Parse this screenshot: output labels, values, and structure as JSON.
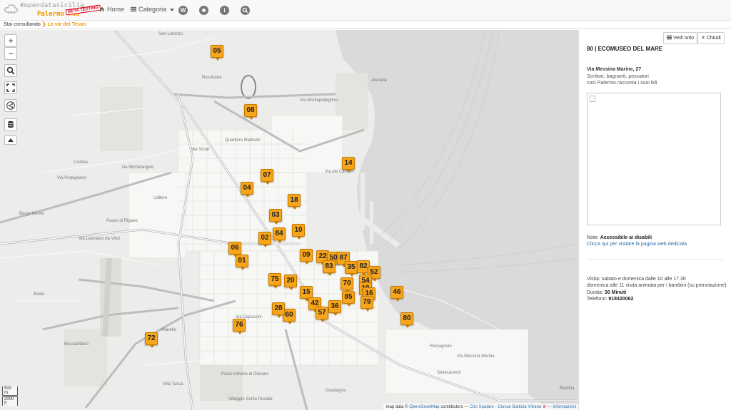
{
  "header": {
    "brand_top": "#opendatasicilia",
    "brand_city": "Palermo Hub",
    "beta_badge": "BETA TESTING",
    "nav": {
      "home": "Home",
      "category": "Categoria"
    },
    "icons": [
      "cloud-logo-icon",
      "home-icon",
      "list-icon",
      "wikipedia-icon",
      "compass-icon",
      "info-icon",
      "search-icon"
    ]
  },
  "breadcrumb": {
    "prefix": "Stai consultando",
    "current": "Le vie dei Tesori"
  },
  "map": {
    "zoom_in": "+",
    "zoom_out": "−",
    "scale_m": "500 m",
    "scale_ft": "2000 ft",
    "attribution": {
      "prefix": "map data ©",
      "osm": "OpenStreetMap",
      "mid": "contributors —",
      "authors": "Ciro Spataro - Giovan Battista Vitrano",
      "info": "— Informazioni"
    },
    "street_labels": [
      "San Lorenzo",
      "Resuttana",
      "Cruillas",
      "Uditore",
      "Borgo Nuovo",
      "Passo di Rigano",
      "Baida",
      "Boccadifalco",
      "Altarello",
      "Arenella",
      "Villa Tasca",
      "Villaggio Santa Rosalia",
      "Guadagna",
      "Settecannoli",
      "Bandita",
      "Romagnolo",
      "Parco Urbano di Orleans",
      "Via Capuccini",
      "Via Perpignano",
      "Via Messina Marine",
      "Via dei Cantieri",
      "Via Montepellegrino",
      "Via Leonardo da Vinci",
      "Via Michelangelo",
      "Via Sciuti",
      "Quartiere Matteotti"
    ],
    "markers": [
      "05",
      "08",
      "07",
      "04",
      "18",
      "14",
      "03",
      "84",
      "10",
      "02",
      "06",
      "01",
      "09",
      "22",
      "50",
      "87",
      "83",
      "35",
      "82",
      "52",
      "75",
      "20",
      "54",
      "70",
      "15",
      "19",
      "16",
      "85",
      "79",
      "46",
      "42",
      "36",
      "57",
      "60",
      "28",
      "80",
      "76",
      "72"
    ],
    "marker_colors": {
      "fill": "#f7a51b",
      "border": "#c77a00"
    }
  },
  "panel": {
    "buttons": {
      "show_all": "Vedi tutto",
      "close": "Chiudi"
    },
    "title": "80 | ECOMUSEO DEL MARE",
    "address": "Via Messina Marine, 27",
    "desc_line1": "Scrittori, bagnanti, pescatori",
    "desc_line2": "così Palermo racconta i suoi lidi",
    "note_label": "Note:",
    "note_value": "Accessibile ai disabili",
    "link": "Clicca qui per visitare la pagina web dedicata",
    "visit": "Visita: sabato e domenica dalle 10 alle 17.30",
    "visit2": "domenica alle 11 visita animata per i bambini (su prenotazione)",
    "duration_label": "Durata:",
    "duration_value": "30 Minuti",
    "phone_label": "Telefono:",
    "phone_value": "918420062"
  },
  "colors": {
    "accent": "#f29400",
    "link": "#2e6da4",
    "sea": "#dcdcdc",
    "land": "#ececea"
  }
}
